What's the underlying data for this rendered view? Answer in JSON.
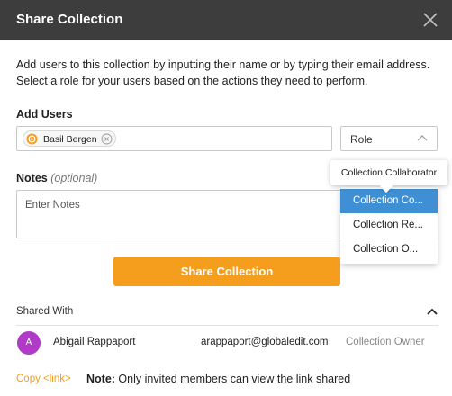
{
  "dialog": {
    "title": "Share Collection",
    "close_icon": "close-icon",
    "description": "Add users to this collection by inputting their name or by typing their email address. Select a role for your users based on the actions they need to perform."
  },
  "add_users": {
    "label": "Add Users",
    "chip": {
      "name": "Basil Bergen",
      "icon": "user-avatar-icon",
      "remove_icon": "remove-x-icon"
    }
  },
  "role": {
    "label": "Role",
    "chevron_icon": "chevron-up-icon",
    "tooltip": "Collection Collaborator",
    "options": [
      "Collection Co...",
      "Collection Re...",
      "Collection O..."
    ],
    "selected_index": 0
  },
  "notes": {
    "label": "Notes",
    "optional": "(optional)",
    "placeholder": "Enter Notes"
  },
  "share_button": "Share Collection",
  "shared_with": {
    "label": "Shared With",
    "collapse_icon": "chevron-up-icon",
    "members": [
      {
        "initial": "A",
        "name": "Abigail Rappaport",
        "email": "arappaport@globaledit.com",
        "role": "Collection Owner"
      }
    ]
  },
  "footer": {
    "copy_link": "Copy <link>",
    "note_label": "Note:",
    "note_text": " Only invited members can view the link shared"
  },
  "colors": {
    "header_bg": "#3d3d3d",
    "accent_orange": "#f59d1c",
    "selected_blue": "#3f8fd4",
    "avatar_purple": "#b03bc6"
  }
}
